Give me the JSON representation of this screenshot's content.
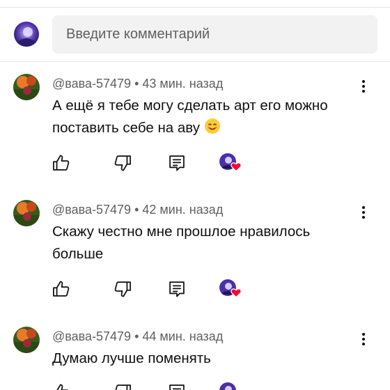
{
  "composer": {
    "placeholder": "Введите комментарий"
  },
  "comments": [
    {
      "author": "@вава-57479",
      "separator": "•",
      "time": "43 мин. назад",
      "text": "А ещё я тебе могу сделать арт его можно поставить себе на аву",
      "emoji": "smiling-face-emoji",
      "liked_by_creator": true
    },
    {
      "author": "@вава-57479",
      "separator": "•",
      "time": "42 мин. назад",
      "text": "Скажу честно мне прошлое нравилось больше",
      "liked_by_creator": true
    },
    {
      "author": "@вава-57479",
      "separator": "•",
      "time": "44 мин. назад",
      "text": "Думаю лучше поменять",
      "liked_by_creator": true
    }
  ],
  "icons": {
    "like": "thumb-up-icon",
    "dislike": "thumb-down-icon",
    "reply": "reply-comment-icon",
    "more": "more-vertical-icon",
    "creator_heart": "heart-icon"
  },
  "colors": {
    "heart": "#ff0033",
    "input_bg": "#f2f2f2",
    "meta_text": "#606060"
  }
}
